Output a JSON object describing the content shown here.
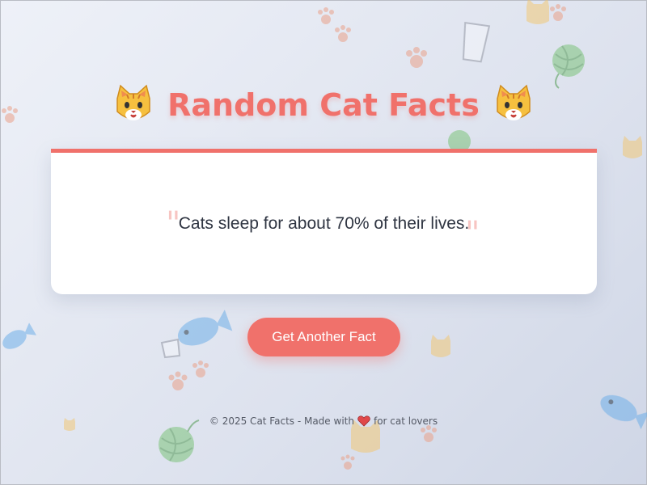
{
  "header": {
    "title": "Random Cat Facts",
    "left_icon": "cat-face-icon",
    "right_icon": "cat-face-icon"
  },
  "fact_card": {
    "text": "Cats sleep for about 70% of their lives.",
    "open_quote": "\"",
    "close_quote": "\""
  },
  "actions": {
    "next_fact_label": "Get Another Fact"
  },
  "footer": {
    "prefix": "© 2025 Cat Facts - Made with",
    "heart_icon": "heart-icon",
    "suffix": "for cat lovers"
  },
  "colors": {
    "accent": "#f0716b",
    "text": "#2f3542",
    "card_bg": "#ffffff"
  }
}
